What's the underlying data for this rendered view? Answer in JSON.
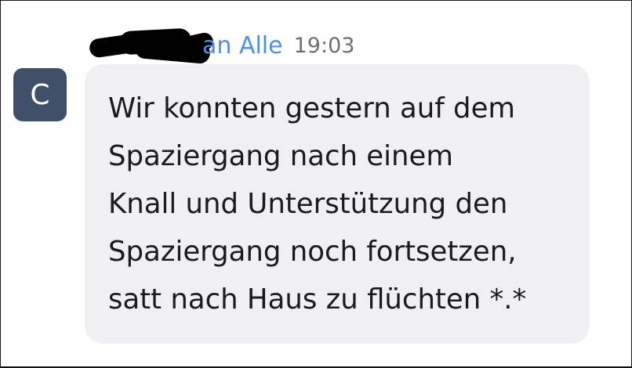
{
  "message": {
    "sender_visible_suffix": "an",
    "recipient": "Alle",
    "time": "19:03",
    "avatar_letter": "C",
    "text": "Wir konnten gestern auf dem\nSpaziergang nach einem\nKnall und Unterstützung den\nSpaziergang noch fortsetzen,\nsatt nach Haus zu flüchten *.*"
  },
  "colors": {
    "sender_link": "#4f8fe6",
    "timestamp": "#6e6e73",
    "avatar_background": "#3f5068",
    "bubble_background": "#f0f0f4",
    "redaction": "#000000"
  },
  "icons": {
    "redaction": "redaction-marker-icon"
  }
}
